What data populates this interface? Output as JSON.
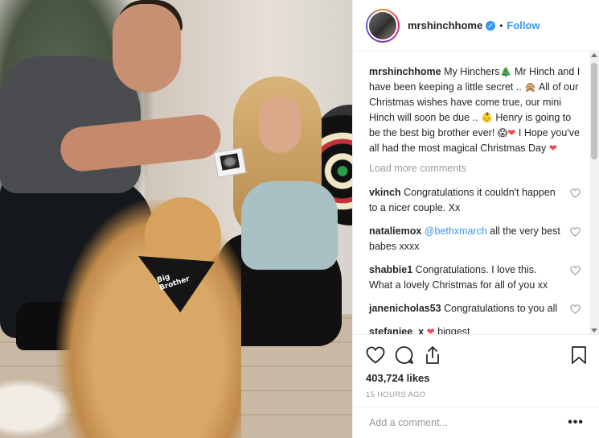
{
  "post": {
    "username": "mrshinchhome",
    "follow_label": "Follow",
    "separator": "•",
    "verified_mark": "✓",
    "photo_text": "Big Brother",
    "caption": {
      "username": "mrshinchhome",
      "segments": [
        {
          "text": " My Hinchers"
        },
        {
          "emoji": "🎄"
        },
        {
          "text": " Mr Hinch and I have been keeping a little secret .. "
        },
        {
          "emoji": "🙊"
        },
        {
          "text": " All of our Christmas wishes have come true, our mini Hinch will soon be due .. "
        },
        {
          "emoji": "👶"
        },
        {
          "text": " Henry is going to be the best big brother ever! "
        },
        {
          "emoji": "😱"
        },
        {
          "emoji": "❤"
        },
        {
          "text": " I Hope you've all had the most magical Christmas Day "
        },
        {
          "emoji": "❤"
        }
      ]
    },
    "load_more": "Load more comments",
    "comments": [
      {
        "username": "vkinch",
        "text": "Congratulations it couldn't happen to a nicer couple. Xx"
      },
      {
        "username": "nataliemox",
        "mention": "@bethxmarch",
        "text": " all the very best babes xxxx"
      },
      {
        "username": "shabbie1",
        "text": "Congratulations. I love this. What a lovely Christmas for all of you xx"
      },
      {
        "username": "janenicholas53",
        "text": "Congratulations to you all"
      },
      {
        "username": "stefaniee_x",
        "emoji": "❤",
        "text": " biggest"
      }
    ],
    "likes": "403,724 likes",
    "time": "15 HOURS AGO",
    "add_comment_placeholder": "Add a comment...",
    "more_options": "•••",
    "icons": [
      "heart-icon",
      "comment-icon",
      "share-icon",
      "bookmark-icon"
    ],
    "colors": {
      "link": "#3897f0",
      "muted": "#999999",
      "text": "#262626",
      "heart": "#ed4956"
    }
  }
}
